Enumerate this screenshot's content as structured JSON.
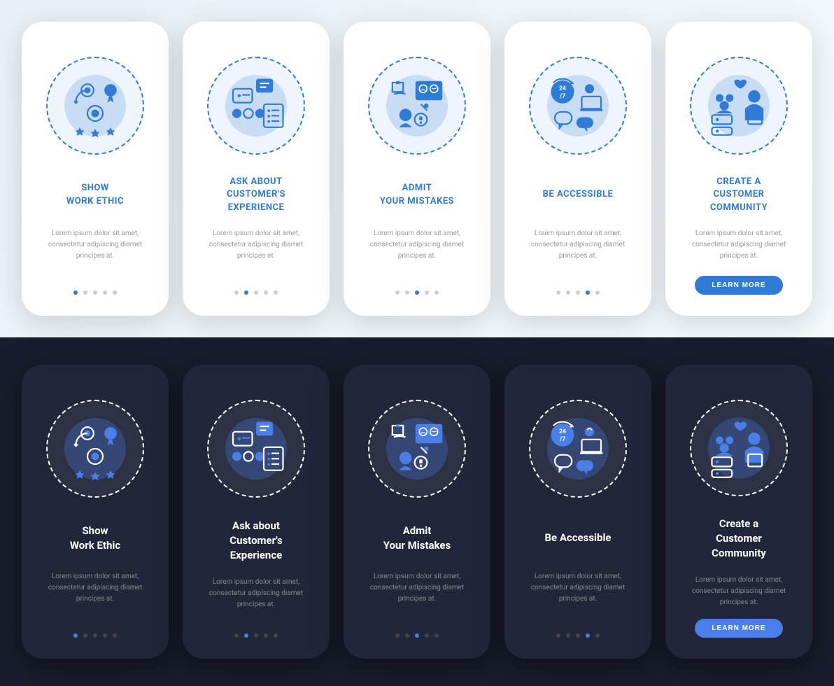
{
  "body_text": "Lorem ipsum dolor sit amet, consectetur adipiscing diamet principes at.",
  "button_label": "LEARN MORE",
  "light": {
    "screens": [
      {
        "title": "SHOW\nWORK ETHIC",
        "active_dot": 0
      },
      {
        "title": "ASK ABOUT\nCUSTOMER'S\nEXPERIENCE",
        "active_dot": 1
      },
      {
        "title": "ADMIT\nYOUR MISTAKES",
        "active_dot": 2
      },
      {
        "title": "BE ACCESSIBLE",
        "active_dot": 3
      },
      {
        "title": "CREATE A\nCUSTOMER\nCOMMUNITY",
        "active_dot": 4,
        "has_button": true
      }
    ]
  },
  "dark": {
    "screens": [
      {
        "title": "Show\nWork Ethic",
        "active_dot": 0
      },
      {
        "title": "Ask about\nCustomer's\nExperience",
        "active_dot": 1
      },
      {
        "title": "Admit\nYour Mistakes",
        "active_dot": 2
      },
      {
        "title": "Be Accessible",
        "active_dot": 3
      },
      {
        "title": "Create a\nCustomer\nCommunity",
        "active_dot": 4,
        "has_button": true
      }
    ]
  },
  "icons": [
    "work-ethic-icon",
    "customer-experience-icon",
    "admit-mistakes-icon",
    "accessible-icon",
    "community-icon"
  ]
}
